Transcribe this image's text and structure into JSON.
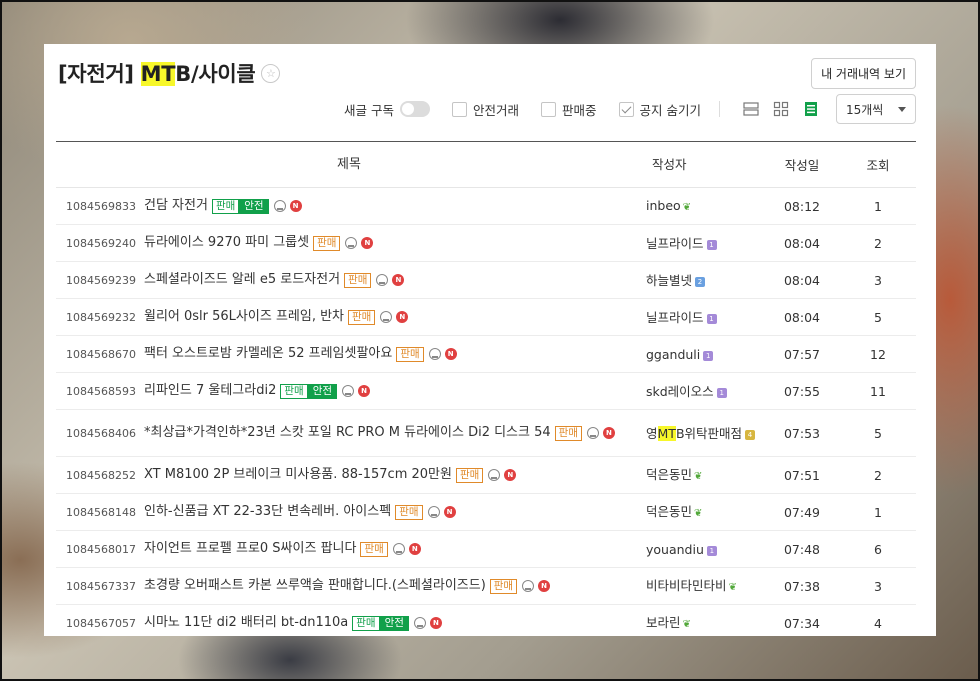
{
  "board": {
    "title_prefix": "[자전거] ",
    "title_highlight": "MT",
    "title_suffix": "B/사이클",
    "history_button": "내 거래내역 보기"
  },
  "options": {
    "subscribe_label": "새글 구독",
    "safe_trade_label": "안전거래",
    "on_sale_label": "판매중",
    "hide_notice_label": "공지 숨기기",
    "per_page": "15개씩"
  },
  "table": {
    "headers": {
      "title": "제목",
      "author": "작성자",
      "date": "작성일",
      "views": "조회"
    },
    "tag_sale": "판매",
    "tag_safe": "안전",
    "new_badge": "N",
    "rows": [
      {
        "num": "1084569833",
        "title": "건담 자전거",
        "tag": "safe",
        "author": "inbeo",
        "badge": "sprout",
        "date": "08:12",
        "views": "1"
      },
      {
        "num": "1084569240",
        "title": "듀라에이스 9270 파미 그룹셋",
        "tag": "sale",
        "author": "닐프라이드",
        "badge": "purple",
        "date": "08:04",
        "views": "2"
      },
      {
        "num": "1084569239",
        "title": "스페셜라이즈드 알레 e5 로드자전거",
        "tag": "sale",
        "author": "하늘별넷",
        "badge": "blue",
        "date": "08:04",
        "views": "3"
      },
      {
        "num": "1084569232",
        "title": "윌리어 0slr 56L사이즈 프레임, 반차",
        "tag": "sale",
        "author": "닐프라이드",
        "badge": "purple",
        "date": "08:04",
        "views": "5"
      },
      {
        "num": "1084568670",
        "title": "팩터 오스트로밤 카멜레온 52 프레임셋팔아요",
        "tag": "sale",
        "author": "gganduli",
        "badge": "purple",
        "date": "07:57",
        "views": "12"
      },
      {
        "num": "1084568593",
        "title": "리파인드 7 울테그라di2",
        "tag": "safe",
        "author": "skd레이오스",
        "badge": "purple",
        "date": "07:55",
        "views": "11"
      },
      {
        "num": "1084568406",
        "title": "*최상급*가격인하*23년 스캇 포일 RC PRO M 듀라에이스 Di2 디스크 54",
        "tag": "sale",
        "author_prefix": "영",
        "author_hl": "MT",
        "author": "B위탁판매점",
        "badge": "gold",
        "date": "07:53",
        "views": "5",
        "tall": true
      },
      {
        "num": "1084568252",
        "title": "XT M8100 2P 브레이크 미사용품. 88-157cm 20만원",
        "tag": "sale",
        "author": "덕은동민",
        "badge": "sprout",
        "date": "07:51",
        "views": "2"
      },
      {
        "num": "1084568148",
        "title": "인하-신품급 XT 22-33단 변속레버. 아이스펙",
        "tag": "sale",
        "author": "덕은동민",
        "badge": "sprout",
        "date": "07:49",
        "views": "1"
      },
      {
        "num": "1084568017",
        "title": "자이언트 프로펠 프로0 S싸이즈 팝니다",
        "tag": "sale",
        "author": "youandiu",
        "badge": "purple",
        "date": "07:48",
        "views": "6"
      },
      {
        "num": "1084567337",
        "title": "초경량 오버패스트 카본 쓰루액슬 판매합니다.(스페셜라이즈드)",
        "tag": "sale",
        "author": "비타비타민타비",
        "badge": "sprout",
        "date": "07:38",
        "views": "3"
      },
      {
        "num": "1084567057",
        "title": "시마노 11단 di2 배터리 bt-dn110a",
        "tag": "safe",
        "author": "보라린",
        "badge": "sprout",
        "date": "07:34",
        "views": "4"
      }
    ]
  },
  "colors": {
    "highlight": "#f7f72a",
    "safe_green": "#11a04a",
    "sale_orange": "#e08a2a",
    "new_red": "#e04040"
  }
}
